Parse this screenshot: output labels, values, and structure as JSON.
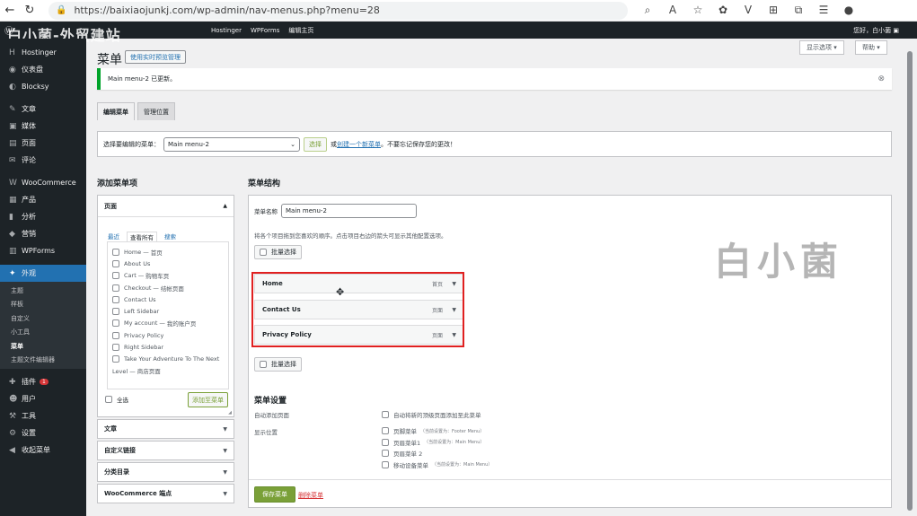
{
  "browser": {
    "url": "https://baixiaojunkj.com/wp-admin/nav-menus.php?menu=28"
  },
  "adminbar": {
    "brand": "白小菌-外贸建站",
    "items": [
      "Hostinger",
      "WPForms",
      "编辑主页"
    ],
    "greeting": "您好，白小菌"
  },
  "sidebar": {
    "items": [
      {
        "label": "Hostinger",
        "icon": "H"
      },
      {
        "label": "仪表盘",
        "icon": "◉"
      },
      {
        "label": "Blocksy",
        "icon": "◐"
      },
      {
        "label": "文章",
        "icon": "✎"
      },
      {
        "label": "媒体",
        "icon": "▣"
      },
      {
        "label": "页面",
        "icon": "▤"
      },
      {
        "label": "评论",
        "icon": "✉"
      },
      {
        "label": "WooCommerce",
        "icon": "W"
      },
      {
        "label": "产品",
        "icon": "▦"
      },
      {
        "label": "分析",
        "icon": "▮"
      },
      {
        "label": "营销",
        "icon": "◆"
      },
      {
        "label": "WPForms",
        "icon": "▥"
      }
    ],
    "active": {
      "label": "外观",
      "icon": "✦"
    },
    "sub": [
      "主题",
      "样板",
      "自定义",
      "小工具",
      "菜单",
      "主题文件编辑器"
    ],
    "after": [
      {
        "label": "插件",
        "icon": "✚",
        "badge": "1"
      },
      {
        "label": "用户",
        "icon": "☻"
      },
      {
        "label": "工具",
        "icon": "⚒"
      },
      {
        "label": "设置",
        "icon": "⚙"
      },
      {
        "label": "收起菜单",
        "icon": "◀"
      }
    ]
  },
  "page": {
    "title": "菜单",
    "live_button": "使用实时预览管理",
    "screen_options": "显示选项",
    "help": "帮助",
    "notice": "Main menu-2 已更新。",
    "tabs": [
      "编辑菜单",
      "管理位置"
    ],
    "select_label": "选择要编辑的菜单：",
    "select_value": "Main menu-2",
    "select_button": "选择",
    "or_text": "或",
    "create_link": "创建一个新菜单",
    "save_note": "。不要忘记保存您的更改！"
  },
  "add_items": {
    "heading": "添加菜单项",
    "pages_title": "页面",
    "subtabs": [
      "最近",
      "查看所有",
      "搜索"
    ],
    "pages": [
      {
        "name": "Home",
        "suffix": "首页"
      },
      {
        "name": "About Us",
        "suffix": ""
      },
      {
        "name": "Cart",
        "suffix": "购物车页"
      },
      {
        "name": "Checkout",
        "suffix": "结帐页面"
      },
      {
        "name": "Contact Us",
        "suffix": ""
      },
      {
        "name": "Left Sidebar",
        "suffix": ""
      },
      {
        "name": "My account",
        "suffix": "我的账户页"
      },
      {
        "name": "Privacy Policy",
        "suffix": ""
      },
      {
        "name": "Right Sidebar",
        "suffix": ""
      },
      {
        "name": "Take Your Adventure To The Next",
        "suffix": ""
      }
    ],
    "wrap_line": "Level — 商店页面",
    "select_all": "全选",
    "add_button": "添加至菜单",
    "accordions": [
      "文章",
      "自定义链接",
      "分类目录",
      "WooCommerce 端点"
    ]
  },
  "structure": {
    "heading": "菜单结构",
    "name_label": "菜单名称",
    "name_value": "Main menu-2",
    "instructions": "将各个项目拖到您喜欢的顺序。点击项目右边的箭头可显示其他配置选项。",
    "bulk_select": "批量选择",
    "items": [
      {
        "title": "Home",
        "type": "首页"
      },
      {
        "title": "Contact Us",
        "type": "页面"
      },
      {
        "title": "Privacy Policy",
        "type": "页面"
      }
    ],
    "settings_heading": "菜单设置",
    "auto_add_label": "自动添加页面",
    "auto_add_text": "自动将新的顶级页面添加至此菜单",
    "locations_label": "显示位置",
    "locations": [
      {
        "name": "页脚菜单",
        "note": "（当前设置为：Footer Menu）"
      },
      {
        "name": "页眉菜单1",
        "note": "（当前设置为：Main Menu）"
      },
      {
        "name": "页眉菜单 2",
        "note": ""
      },
      {
        "name": "移动设备菜单",
        "note": "（当前设置为：Main Menu）"
      }
    ],
    "save_button": "保存菜单",
    "delete_link": "删除菜单"
  },
  "watermark": "白小菌"
}
